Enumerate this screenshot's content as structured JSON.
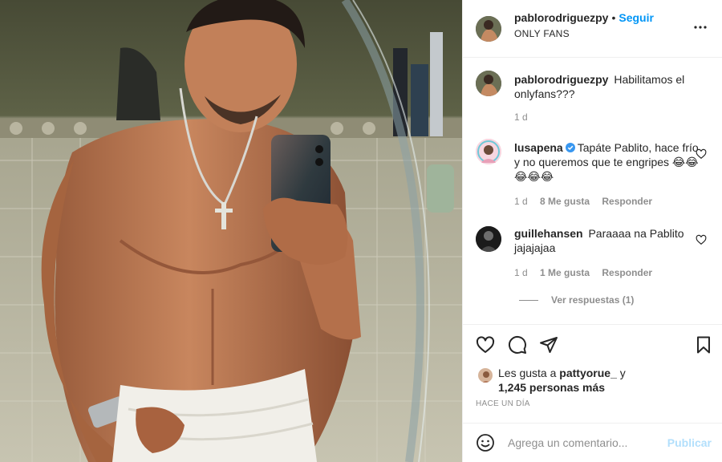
{
  "post": {
    "author": "pablorodriguezpy",
    "follow_label": "Seguir",
    "subtitle": "ONLY FANS",
    "caption": "Habilitamos el onlyfans???",
    "caption_age": "1 d",
    "time_label": "HACE UN DÍA"
  },
  "comments": [
    {
      "user": "lusapena",
      "verified": true,
      "text": "Tapáte Pablito, hace frío y no queremos que te engripes 😂😂😂😂😂",
      "age": "1 d",
      "likes": "8 Me gusta",
      "reply": "Responder"
    },
    {
      "user": "guillehansen",
      "verified": false,
      "text": "Paraaaa na Pablito jajajajaa",
      "age": "1 d",
      "likes": "1 Me gusta",
      "reply": "Responder"
    }
  ],
  "view_replies": "Ver respuestas (1)",
  "likes": {
    "prefix": "Les gusta a",
    "liker": "pattyorue_",
    "suffix": "y",
    "count": "1,245 personas más"
  },
  "composer": {
    "placeholder": "Agrega un comentario...",
    "publish": "Publicar"
  },
  "icons": {
    "header": [
      "more-icon"
    ],
    "actions": [
      "heart-icon",
      "comment-icon",
      "share-icon",
      "bookmark-icon"
    ],
    "composer": [
      "emoji-icon"
    ]
  },
  "colors": {
    "link_blue": "#0095f6",
    "publish_disabled": "#b2dffc",
    "muted": "#8e8e8e",
    "verified_blue": "#3897f0"
  }
}
